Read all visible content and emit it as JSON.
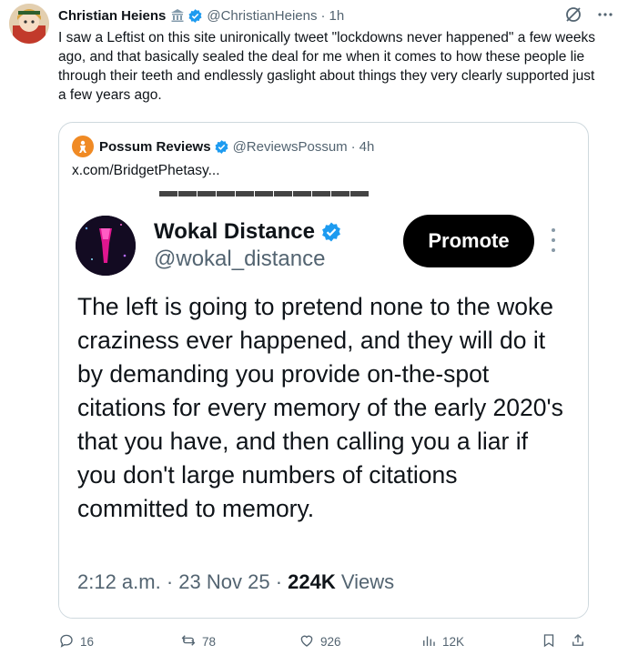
{
  "tweet": {
    "author_name": "Christian Heiens",
    "author_handle": "@ChristianHeiens",
    "separator": "·",
    "time": "1h",
    "text": "I saw a Leftist on this site unironically tweet \"lockdowns never happened\" a few weeks ago, and that basically sealed the deal for me when it comes to how these people lie through their teeth and endlessly gaslight about things they very clearly supported just a few years ago."
  },
  "quote": {
    "author_name": "Possum Reviews",
    "author_handle": "@ReviewsPossum",
    "separator": "·",
    "time": "4h",
    "link": "x.com/BridgetPhetasy..."
  },
  "screenshot": {
    "author_name": "Wokal Distance",
    "author_handle": "@wokal_distance",
    "promote_label": "Promote",
    "text": "The left is going to pretend none to the woke craziness ever happened, and they will do it by demanding you provide on-the-spot citations for every memory of the early 2020's that you have, and then calling you a liar if you don't large numbers of citations committed to memory.",
    "time": "2:12 a.m.",
    "sep1": " · ",
    "date": "23 Nov 25",
    "sep2": " · ",
    "views_count": "224K",
    "views_label": " Views"
  },
  "actions": {
    "replies": "16",
    "reposts": "78",
    "likes": "926",
    "views": "12K"
  },
  "colors": {
    "verified": "#1d9bf0",
    "muted": "#536471",
    "border": "#cfd9de",
    "text": "#0f1419"
  },
  "icons": [
    "government-badge-icon",
    "verified-badge-icon",
    "grok-icon",
    "more-icon",
    "reply-icon",
    "repost-icon",
    "like-icon",
    "views-icon",
    "bookmark-icon",
    "share-icon"
  ]
}
